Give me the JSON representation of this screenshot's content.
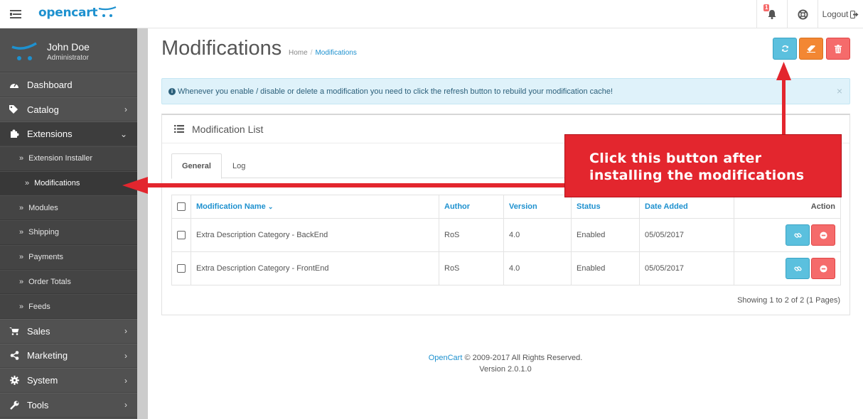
{
  "header": {
    "logo": "opencart",
    "notification_count": "1",
    "logout_label": "Logout"
  },
  "sidebar": {
    "user_name": "John Doe",
    "user_role": "Administrator",
    "items": [
      {
        "label": "Dashboard",
        "icon": "dashboard-icon"
      },
      {
        "label": "Catalog",
        "icon": "tags-icon"
      },
      {
        "label": "Extensions",
        "icon": "puzzle-icon"
      },
      {
        "label": "Sales",
        "icon": "cart-icon"
      },
      {
        "label": "Marketing",
        "icon": "share-icon"
      },
      {
        "label": "System",
        "icon": "gear-icon"
      },
      {
        "label": "Tools",
        "icon": "wrench-icon"
      }
    ],
    "extension_subitems": [
      "Extension Installer",
      "Modifications",
      "Modules",
      "Shipping",
      "Payments",
      "Order Totals",
      "Feeds"
    ]
  },
  "page": {
    "title": "Modifications",
    "breadcrumb_home": "Home",
    "breadcrumb_current": "Modifications",
    "alert_text": "Whenever you enable / disable or delete a modification you need to click the refresh button to rebuild your modification cache!",
    "alert_close": "×"
  },
  "panel": {
    "title": "Modification List",
    "tabs": [
      "General",
      "Log"
    ],
    "columns": [
      "Modification Name",
      "Author",
      "Version",
      "Status",
      "Date Added",
      "Action"
    ],
    "rows": [
      {
        "name": "Extra Description Category - BackEnd",
        "author": "RoS",
        "version": "4.0",
        "status": "Enabled",
        "date": "05/05/2017"
      },
      {
        "name": "Extra Description Category - FrontEnd",
        "author": "RoS",
        "version": "4.0",
        "status": "Enabled",
        "date": "05/05/2017"
      }
    ],
    "pagination_text": "Showing 1 to 2 of 2 (1 Pages)"
  },
  "footer": {
    "brand": "OpenCart",
    "copyright": " © 2009-2017 All Rights Reserved.",
    "version": "Version 2.0.1.0"
  },
  "annotation": {
    "line1": "Click this button after",
    "line2": "installing the modifications",
    "color": "#e3262e"
  }
}
